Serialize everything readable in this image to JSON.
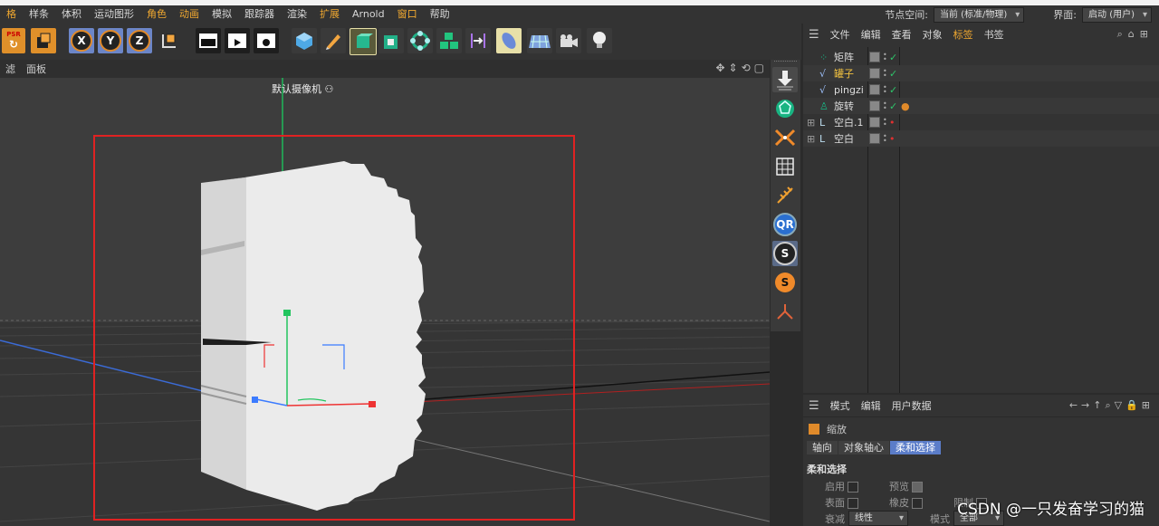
{
  "menu": {
    "items": [
      "格",
      "样条",
      "体积",
      "运动图形",
      "角色",
      "动画",
      "模拟",
      "跟踪器",
      "渲染",
      "扩展",
      "Arnold",
      "窗口",
      "帮助"
    ],
    "highlighted": [
      "格",
      "角色",
      "动画",
      "扩展",
      "窗口"
    ],
    "node_space_label": "节点空间:",
    "node_space_value": "当前 (标准/物理)",
    "interface_label": "界面:",
    "interface_value": "启动 (用户)"
  },
  "toolbar": {
    "psr_label": "PSR",
    "x_label": "X",
    "y_label": "Y",
    "z_label": "Z"
  },
  "viewport": {
    "menu": [
      "滤",
      "面板"
    ],
    "camera_label": "默认摄像机"
  },
  "object_manager": {
    "tabs": [
      "文件",
      "编辑",
      "查看",
      "对象",
      "标签",
      "书签"
    ],
    "highlighted_tab": "标签",
    "objects": [
      {
        "name": "矩阵",
        "icon": "matrix-icon",
        "highlight": false,
        "status": "✓"
      },
      {
        "name": "罐子",
        "icon": "spline-icon",
        "highlight": true,
        "status": "✓"
      },
      {
        "name": "pingzi",
        "icon": "spline-icon",
        "highlight": false,
        "status": "✓"
      },
      {
        "name": "旋转",
        "icon": "lathe-icon",
        "highlight": false,
        "status": "✓"
      },
      {
        "name": "空白.1",
        "icon": "null-icon",
        "highlight": false,
        "status": "•"
      },
      {
        "name": "空白",
        "icon": "null-icon",
        "highlight": false,
        "status": "•"
      }
    ]
  },
  "attributes": {
    "tabs": [
      "模式",
      "编辑",
      "用户数据"
    ],
    "title": "缩放",
    "subtabs": [
      "轴向",
      "对象轴心",
      "柔和选择"
    ],
    "active_subtab": "柔和选择",
    "section": "柔和选择",
    "enable_label": "启用",
    "preview_label": "预览",
    "surface_label": "表面",
    "rubber_label": "橡皮",
    "limit_label": "限制",
    "falloff_label": "衰减",
    "falloff_value": "线性",
    "mode_label": "模式",
    "mode_value": "全部"
  },
  "watermark": "CSDN @一只发奋学习的猫"
}
